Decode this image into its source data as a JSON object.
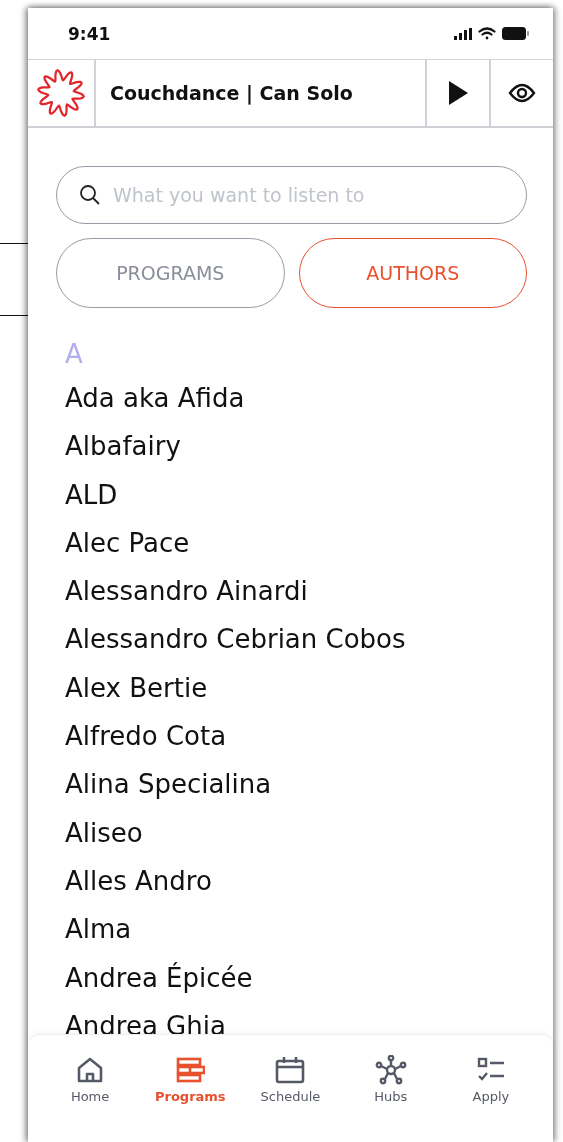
{
  "status_bar": {
    "time": "9:41"
  },
  "header": {
    "title": "Couchdance | Can Solo"
  },
  "search": {
    "placeholder": "What you want to listen to"
  },
  "tabs": [
    {
      "label": "PROGRAMS",
      "selected": false
    },
    {
      "label": "AUTHORS",
      "selected": true
    }
  ],
  "list": {
    "letter": "A",
    "authors": [
      "Ada aka Afida",
      "Albafairy",
      "ALD",
      "Alec Pace",
      "Alessandro Ainardi",
      "Alessandro Cebrian Cobos",
      "Alex Bertie",
      "Alfredo Cota",
      "Alina Specialina",
      "Aliseo",
      "Alles Andro",
      "Alma",
      "Andrea Épicée",
      "Andrea Ghia"
    ]
  },
  "nav": [
    {
      "label": "Home",
      "kind": "home",
      "selected": false
    },
    {
      "label": "Programs",
      "kind": "programs",
      "selected": true
    },
    {
      "label": "Schedule",
      "kind": "calendar",
      "selected": false
    },
    {
      "label": "Hubs",
      "kind": "hubs",
      "selected": false
    },
    {
      "label": "Apply",
      "kind": "checklist",
      "selected": false
    }
  ]
}
